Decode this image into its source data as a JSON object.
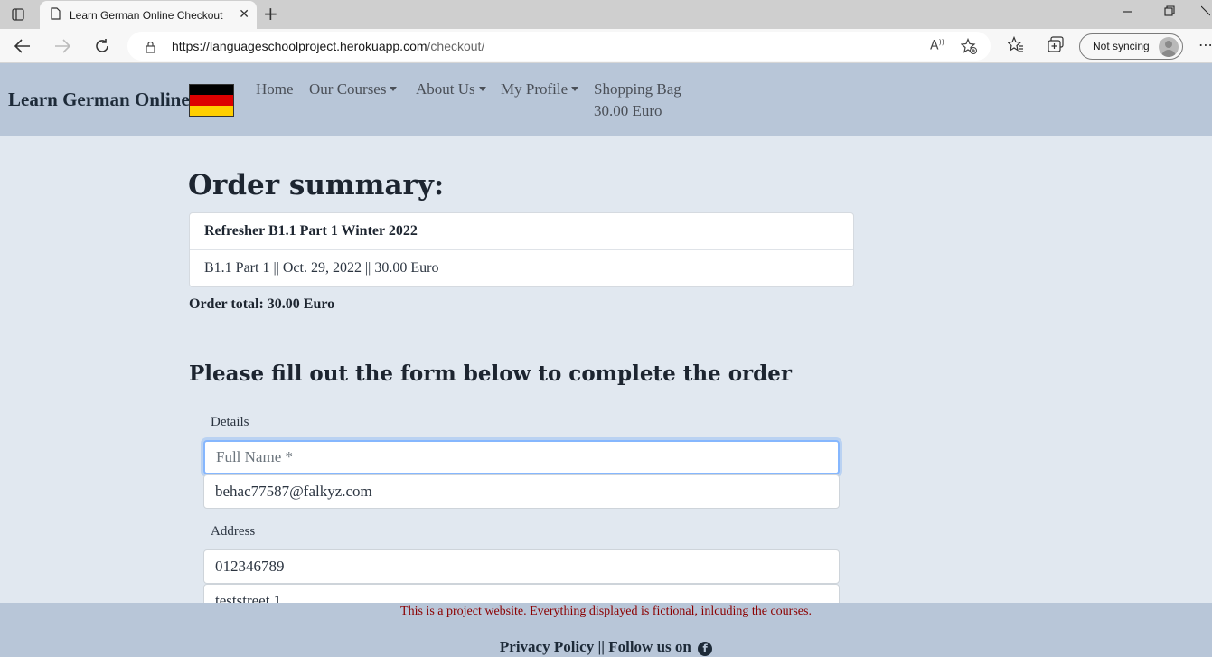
{
  "browser": {
    "tab_title": "Learn German Online Checkout",
    "tab_close": "✕",
    "new_tab": "+",
    "url_host": "https://languageschoolproject.herokuapp.com",
    "url_path": "/checkout/",
    "sync_label": "Not syncing",
    "icons": [
      "tab-actions-icon",
      "page-icon",
      "back-icon",
      "forward-icon",
      "refresh-icon",
      "lock-icon",
      "read-aloud-icon",
      "add-favorite-icon",
      "favorites-icon",
      "collections-icon",
      "profile-avatar-icon",
      "more-menu-icon",
      "minimize-icon",
      "restore-icon",
      "close-window-icon"
    ]
  },
  "navbar": {
    "brand": "Learn German Online",
    "flag_colors": [
      "#000000",
      "#dd0000",
      "#ffce00"
    ],
    "links": [
      {
        "label": "Home"
      },
      {
        "label": "Our Courses"
      },
      {
        "label": "About Us"
      },
      {
        "label": "My Profile"
      },
      {
        "label": "Shopping Bag"
      }
    ],
    "bag_total": "30.00 Euro"
  },
  "summary": {
    "heading": "Order summary:",
    "item_title": "Refresher B1.1 Part 1 Winter 2022",
    "item_details": "B1.1 Part 1 || Oct. 29, 2022 || 30.00 Euro",
    "order_total": "Order total: 30.00 Euro"
  },
  "form": {
    "heading": "Please fill out the form below to complete the order",
    "details_label": "Details",
    "full_name_placeholder": "Full Name *",
    "email_value": "behac77587@falkyz.com",
    "address_label": "Address",
    "phone_value": "012346789",
    "street_value": "teststreet 1"
  },
  "footer": {
    "disclaimer": "This is a project website. Everything displayed is fictional, inlcuding the courses.",
    "privacy": "Privacy Policy",
    "separator": "||",
    "follow": "Follow us on"
  },
  "colors": {
    "navbar_bg": "#b8c6d8",
    "page_bg": "#e1e8f0",
    "disclaimer_text": "#8b0000",
    "focus_ring": "#86b7fe"
  }
}
